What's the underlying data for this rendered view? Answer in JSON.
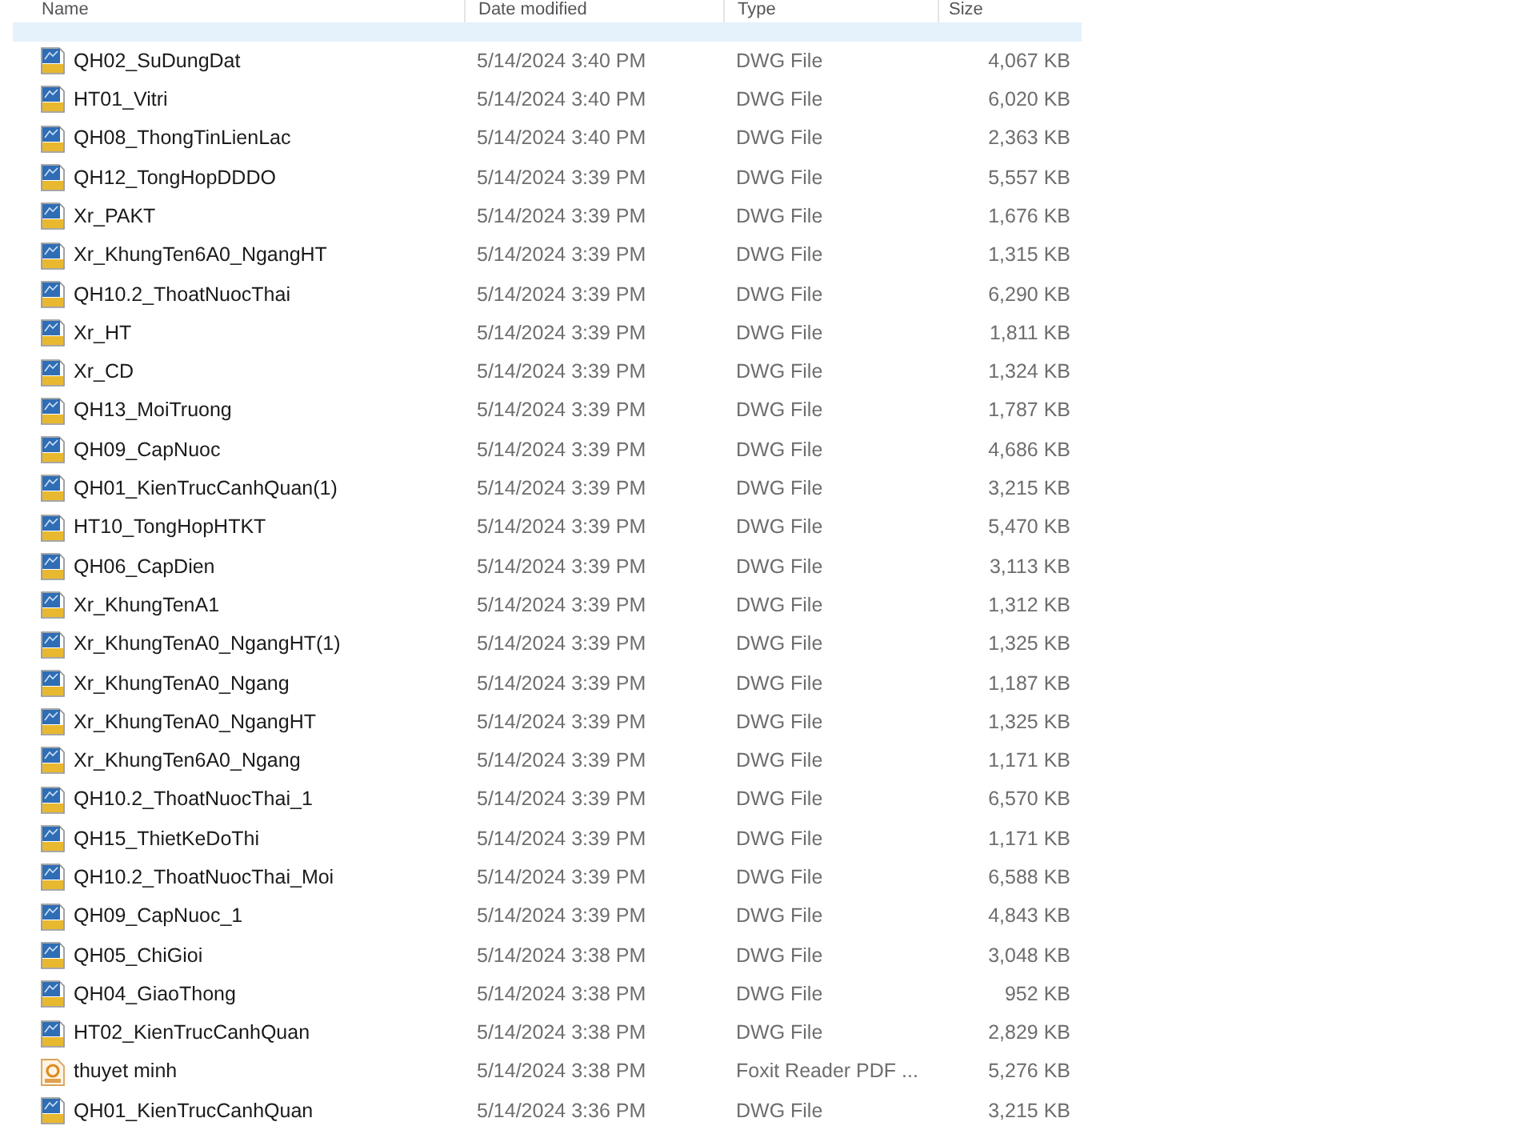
{
  "columns": [
    "Name",
    "Date modified",
    "Type",
    "Size"
  ],
  "cut_row": {
    "selected": true
  },
  "files": [
    {
      "name": "QH02_SuDungDat",
      "date": "5/14/2024 3:40 PM",
      "type": "DWG File",
      "size": "4,067 KB",
      "kind": "dwg"
    },
    {
      "name": "HT01_Vitri",
      "date": "5/14/2024 3:40 PM",
      "type": "DWG File",
      "size": "6,020 KB",
      "kind": "dwg"
    },
    {
      "name": "QH08_ThongTinLienLac",
      "date": "5/14/2024 3:40 PM",
      "type": "DWG File",
      "size": "2,363 KB",
      "kind": "dwg"
    },
    {
      "name": "QH12_TongHopDDDO",
      "date": "5/14/2024 3:39 PM",
      "type": "DWG File",
      "size": "5,557 KB",
      "kind": "dwg"
    },
    {
      "name": "Xr_PAKT",
      "date": "5/14/2024 3:39 PM",
      "type": "DWG File",
      "size": "1,676 KB",
      "kind": "dwg"
    },
    {
      "name": "Xr_KhungTen6A0_NgangHT",
      "date": "5/14/2024 3:39 PM",
      "type": "DWG File",
      "size": "1,315 KB",
      "kind": "dwg"
    },
    {
      "name": "QH10.2_ThoatNuocThai",
      "date": "5/14/2024 3:39 PM",
      "type": "DWG File",
      "size": "6,290 KB",
      "kind": "dwg"
    },
    {
      "name": "Xr_HT",
      "date": "5/14/2024 3:39 PM",
      "type": "DWG File",
      "size": "1,811 KB",
      "kind": "dwg"
    },
    {
      "name": "Xr_CD",
      "date": "5/14/2024 3:39 PM",
      "type": "DWG File",
      "size": "1,324 KB",
      "kind": "dwg"
    },
    {
      "name": "QH13_MoiTruong",
      "date": "5/14/2024 3:39 PM",
      "type": "DWG File",
      "size": "1,787 KB",
      "kind": "dwg"
    },
    {
      "name": "QH09_CapNuoc",
      "date": "5/14/2024 3:39 PM",
      "type": "DWG File",
      "size": "4,686 KB",
      "kind": "dwg"
    },
    {
      "name": "QH01_KienTrucCanhQuan(1)",
      "date": "5/14/2024 3:39 PM",
      "type": "DWG File",
      "size": "3,215 KB",
      "kind": "dwg"
    },
    {
      "name": "HT10_TongHopHTKT",
      "date": "5/14/2024 3:39 PM",
      "type": "DWG File",
      "size": "5,470 KB",
      "kind": "dwg"
    },
    {
      "name": "QH06_CapDien",
      "date": "5/14/2024 3:39 PM",
      "type": "DWG File",
      "size": "3,113 KB",
      "kind": "dwg"
    },
    {
      "name": "Xr_KhungTenA1",
      "date": "5/14/2024 3:39 PM",
      "type": "DWG File",
      "size": "1,312 KB",
      "kind": "dwg"
    },
    {
      "name": "Xr_KhungTenA0_NgangHT(1)",
      "date": "5/14/2024 3:39 PM",
      "type": "DWG File",
      "size": "1,325 KB",
      "kind": "dwg"
    },
    {
      "name": "Xr_KhungTenA0_Ngang",
      "date": "5/14/2024 3:39 PM",
      "type": "DWG File",
      "size": "1,187 KB",
      "kind": "dwg"
    },
    {
      "name": "Xr_KhungTenA0_NgangHT",
      "date": "5/14/2024 3:39 PM",
      "type": "DWG File",
      "size": "1,325 KB",
      "kind": "dwg"
    },
    {
      "name": "Xr_KhungTen6A0_Ngang",
      "date": "5/14/2024 3:39 PM",
      "type": "DWG File",
      "size": "1,171 KB",
      "kind": "dwg"
    },
    {
      "name": "QH10.2_ThoatNuocThai_1",
      "date": "5/14/2024 3:39 PM",
      "type": "DWG File",
      "size": "6,570 KB",
      "kind": "dwg"
    },
    {
      "name": "QH15_ThietKeDoThi",
      "date": "5/14/2024 3:39 PM",
      "type": "DWG File",
      "size": "1,171 KB",
      "kind": "dwg"
    },
    {
      "name": "QH10.2_ThoatNuocThai_Moi",
      "date": "5/14/2024 3:39 PM",
      "type": "DWG File",
      "size": "6,588 KB",
      "kind": "dwg"
    },
    {
      "name": "QH09_CapNuoc_1",
      "date": "5/14/2024 3:39 PM",
      "type": "DWG File",
      "size": "4,843 KB",
      "kind": "dwg"
    },
    {
      "name": "QH05_ChiGioi",
      "date": "5/14/2024 3:38 PM",
      "type": "DWG File",
      "size": "3,048 KB",
      "kind": "dwg"
    },
    {
      "name": "QH04_GiaoThong",
      "date": "5/14/2024 3:38 PM",
      "type": "DWG File",
      "size": "952 KB",
      "kind": "dwg"
    },
    {
      "name": "HT02_KienTrucCanhQuan",
      "date": "5/14/2024 3:38 PM",
      "type": "DWG File",
      "size": "2,829 KB",
      "kind": "dwg"
    },
    {
      "name": "thuyet minh",
      "date": "5/14/2024 3:38 PM",
      "type": "Foxit Reader PDF ...",
      "size": "5,276 KB",
      "kind": "pdf"
    },
    {
      "name": "QH01_KienTrucCanhQuan",
      "date": "5/14/2024 3:36 PM",
      "type": "DWG File",
      "size": "3,215 KB",
      "kind": "dwg"
    }
  ]
}
